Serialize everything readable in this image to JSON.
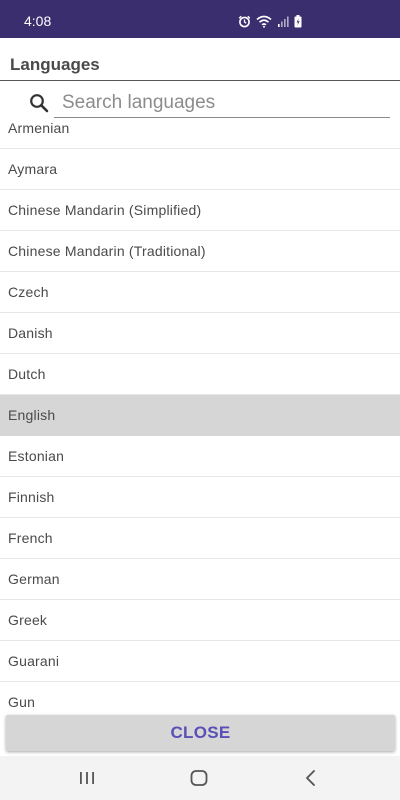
{
  "status_bar": {
    "time": "4:08",
    "icons": [
      "alarm-icon",
      "wifi-icon",
      "signal-icon",
      "battery-icon"
    ],
    "background": "#3b2e6e"
  },
  "header": {
    "title": "Languages"
  },
  "search": {
    "placeholder": "Search languages",
    "value": ""
  },
  "languages": [
    {
      "label": "Armenian",
      "selected": false
    },
    {
      "label": "Aymara",
      "selected": false
    },
    {
      "label": "Chinese Mandarin (Simplified)",
      "selected": false
    },
    {
      "label": "Chinese Mandarin (Traditional)",
      "selected": false
    },
    {
      "label": "Czech",
      "selected": false
    },
    {
      "label": "Danish",
      "selected": false
    },
    {
      "label": "Dutch",
      "selected": false
    },
    {
      "label": "English",
      "selected": true
    },
    {
      "label": "Estonian",
      "selected": false
    },
    {
      "label": "Finnish",
      "selected": false
    },
    {
      "label": "French",
      "selected": false
    },
    {
      "label": "German",
      "selected": false
    },
    {
      "label": "Greek",
      "selected": false
    },
    {
      "label": "Guarani",
      "selected": false
    },
    {
      "label": "Gun",
      "selected": false
    }
  ],
  "close_button": {
    "label": "CLOSE",
    "color": "#5a4fb6"
  },
  "nav_bar": {
    "buttons": [
      "recent-apps-icon",
      "home-icon",
      "back-icon"
    ]
  }
}
